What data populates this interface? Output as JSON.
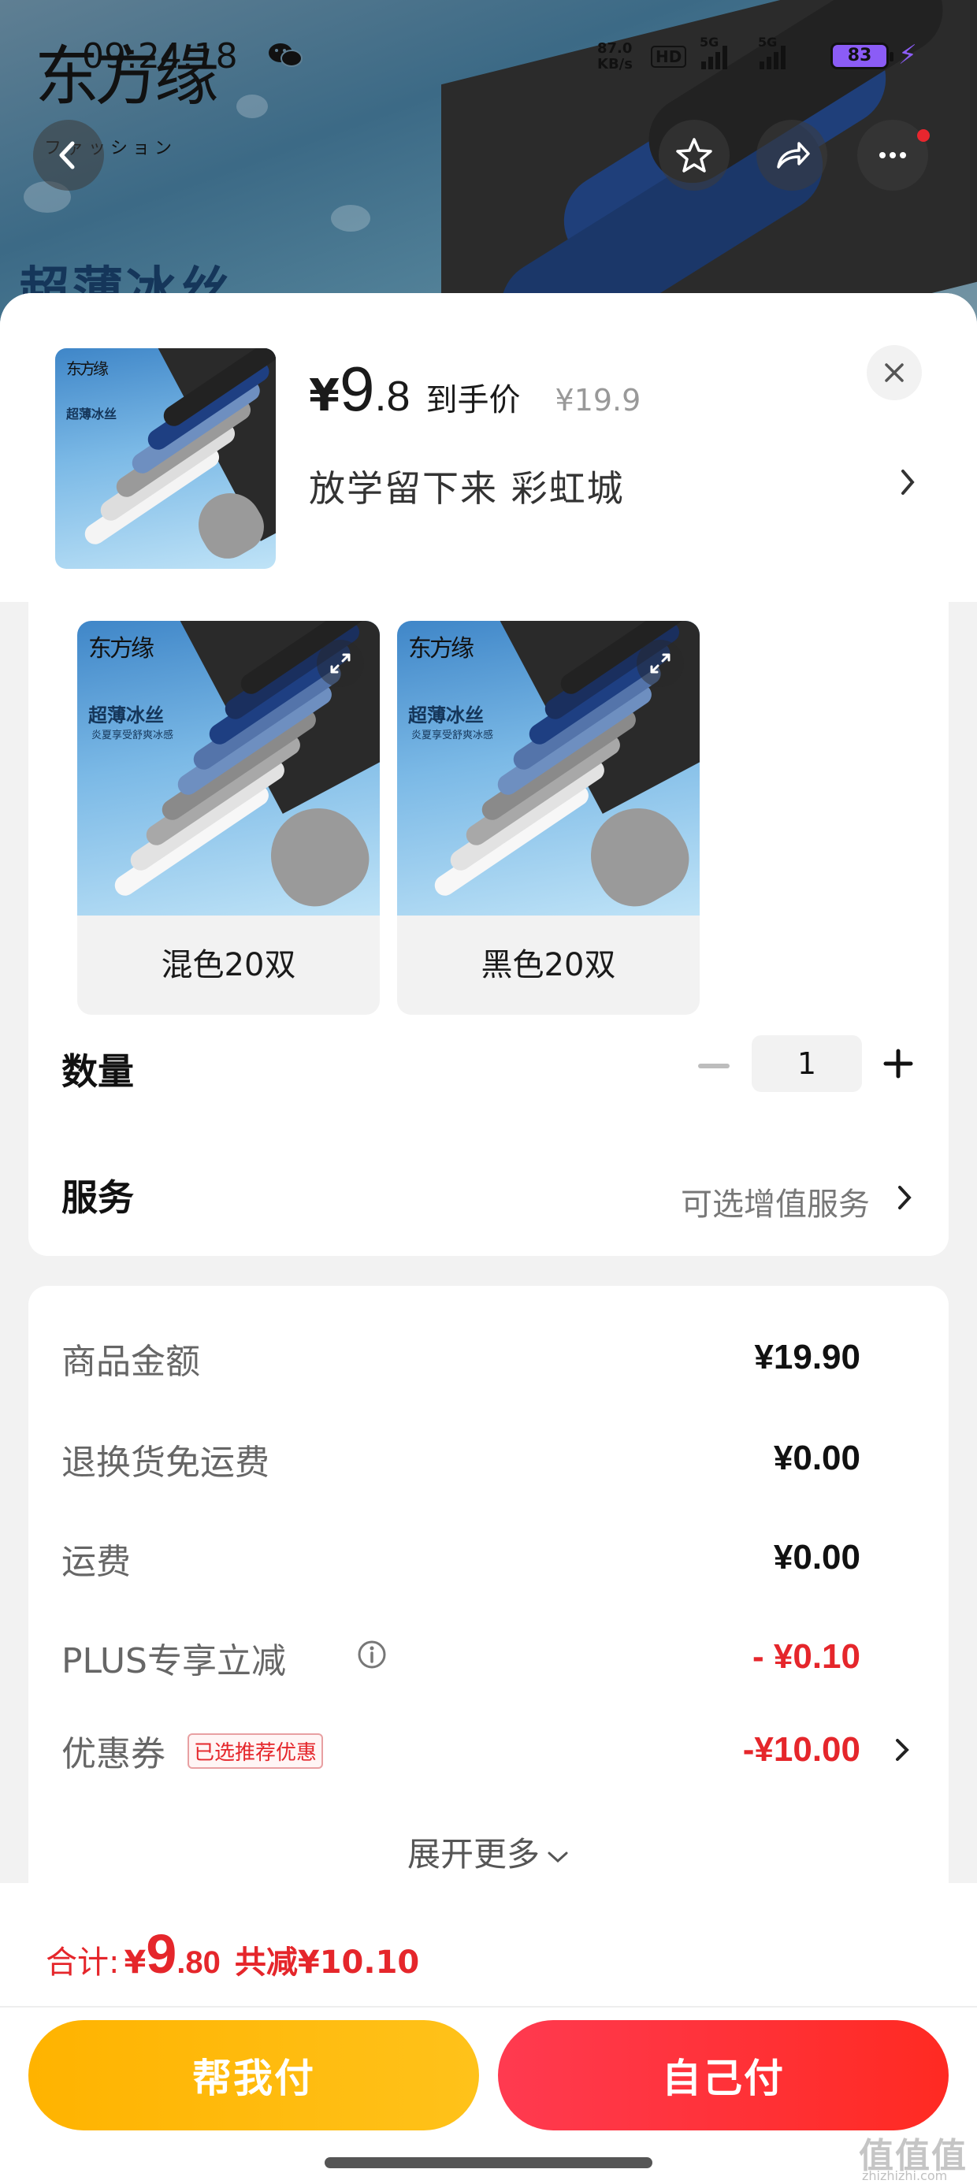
{
  "status_bar": {
    "time": "09:24:18",
    "network_speed": "87.0\nKB/s",
    "hd_label": "HD",
    "signal1_label": "5G",
    "signal2_label": "5G",
    "battery": "83"
  },
  "hero": {
    "brand": "东方缘",
    "brand_sub": "ファッション",
    "tagline": "超薄冰丝"
  },
  "product": {
    "price_symbol": "¥",
    "price_int": "9",
    "price_dec": ".8",
    "price_label": "到手价",
    "original_price": "¥19.9",
    "selected_variant": "放学留下来  彩虹城",
    "thumb_brand": "东方缘",
    "thumb_tagline": "超薄冰丝",
    "thumb_subtag": "炎夏享受舒爽冰感"
  },
  "options": [
    {
      "label": "混色20双"
    },
    {
      "label": "黑色20双"
    }
  ],
  "quantity": {
    "label": "数量",
    "value": "1"
  },
  "service": {
    "label": "服务",
    "value": "可选增值服务"
  },
  "fees": [
    {
      "key": "商品金额",
      "value": "¥19.90",
      "red": false
    },
    {
      "key": "退换货免运费",
      "value": "¥0.00",
      "red": false
    },
    {
      "key": "运费",
      "value": "¥0.00",
      "red": false
    },
    {
      "key": "PLUS专享立减",
      "value": "- ¥0.10",
      "red": true
    },
    {
      "key": "优惠券",
      "value": "-¥10.00",
      "red": true,
      "tag": "已选推荐优惠"
    }
  ],
  "expand_label": "展开更多",
  "total": {
    "label": "合计:",
    "symbol": "¥",
    "int": "9",
    "dec": ".80",
    "saved": "共减¥10.10"
  },
  "buttons": {
    "help_pay": "帮我付",
    "self_pay": "自己付"
  },
  "watermark": {
    "main": "值值值",
    "sub": "zhizhizhi.com"
  },
  "colors": {
    "accent_red": "#e5262b",
    "help_yellow": "#ffb300",
    "self_red": "#ff2a22",
    "battery": "#8b5cf6"
  }
}
